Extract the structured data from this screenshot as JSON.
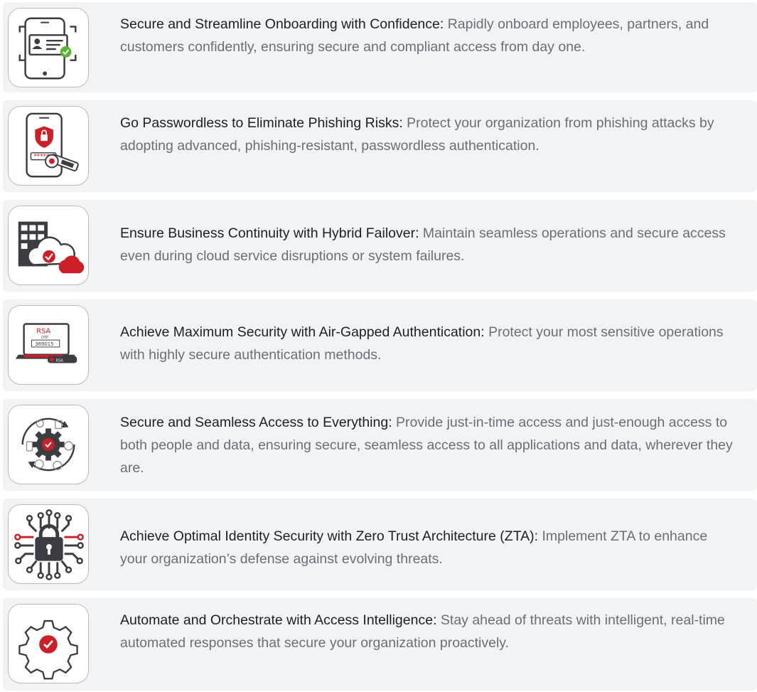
{
  "colors": {
    "card_bg": "#f2f3f5",
    "accent_red": "#cc1f27",
    "dark": "#3b3d42",
    "title_text": "#1c1f24",
    "body_text": "#6a6f77"
  },
  "items": [
    {
      "icon": "id-card-verification-icon",
      "title": "Secure and Streamline Onboarding with Confidence:",
      "text": " Rapidly onboard employees, partners, and customers confidently, ensuring secure and compliant access from day one."
    },
    {
      "icon": "passwordless-key-icon",
      "title": "Go Passwordless to Eliminate Phishing Risks:",
      "text": " Protect your organization from phishing attacks by adopting advanced, phishing-resistant, passwordless authentication."
    },
    {
      "icon": "hybrid-cloud-failover-icon",
      "title": "Ensure Business Continuity with Hybrid Failover:",
      "text": " Maintain seamless operations and secure access even during cloud service disruptions or system failures."
    },
    {
      "icon": "air-gapped-token-icon",
      "title": "Achieve Maximum Security with Air-Gapped Authentication:",
      "text": " Protect your most sensitive operations with highly secure authentication methods.",
      "icon_labels": {
        "brand": "RSA",
        "otp_label": "OTP",
        "otp_code": "369015",
        "usb_label": "RSA"
      }
    },
    {
      "icon": "seamless-access-cycle-icon",
      "title": "Secure and Seamless Access to Everything:",
      "text": " Provide just-in-time access and just-enough access to both people and data, ensuring secure, seamless access to all applications and data, wherever they are."
    },
    {
      "icon": "zero-trust-lock-circuit-icon",
      "title": "Achieve Optimal Identity Security with Zero Trust Architecture (ZTA):",
      "text": " Implement ZTA to enhance your organization’s defense against evolving threats."
    },
    {
      "icon": "gear-check-icon",
      "title": "Automate and Orchestrate with Access Intelligence:",
      "text": " Stay ahead of threats with intelligent, real-time automated responses that secure your organization proactively."
    }
  ]
}
